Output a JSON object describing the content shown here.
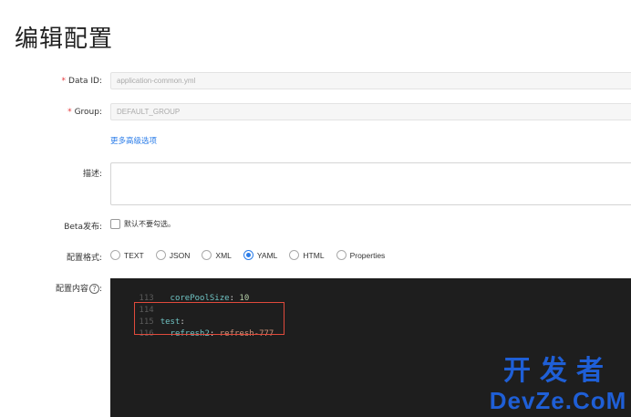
{
  "page": {
    "title": "编辑配置"
  },
  "form": {
    "data_id": {
      "label": "Data ID:",
      "required_mark": "*",
      "value": "application-common.yml"
    },
    "group": {
      "label": "Group:",
      "required_mark": "*",
      "value": "DEFAULT_GROUP"
    },
    "advanced_link": "更多高级选项",
    "description": {
      "label": "描述:",
      "value": ""
    },
    "beta": {
      "label": "Beta发布:",
      "checkbox_label": "默认不要勾选。",
      "checked": false
    },
    "format": {
      "label": "配置格式:",
      "options": [
        "TEXT",
        "JSON",
        "XML",
        "YAML",
        "HTML",
        "Properties"
      ],
      "selected": "YAML"
    },
    "content": {
      "label": "配置内容",
      "help_icon": "?"
    }
  },
  "editor": {
    "lines": [
      {
        "num": "113",
        "indent": "  ",
        "key": "corePoolSize",
        "sep": ": ",
        "value": "10"
      },
      {
        "num": "114",
        "indent": "",
        "key": "",
        "sep": "",
        "value": ""
      },
      {
        "num": "115",
        "indent": "",
        "key": "test",
        "sep": ":",
        "value": ""
      },
      {
        "num": "116",
        "indent": "  ",
        "key": "refresh2",
        "sep": ": ",
        "value": "refresh-777"
      }
    ]
  },
  "watermark": {
    "line1": "开发者",
    "line2": "DevZe.CoM"
  }
}
